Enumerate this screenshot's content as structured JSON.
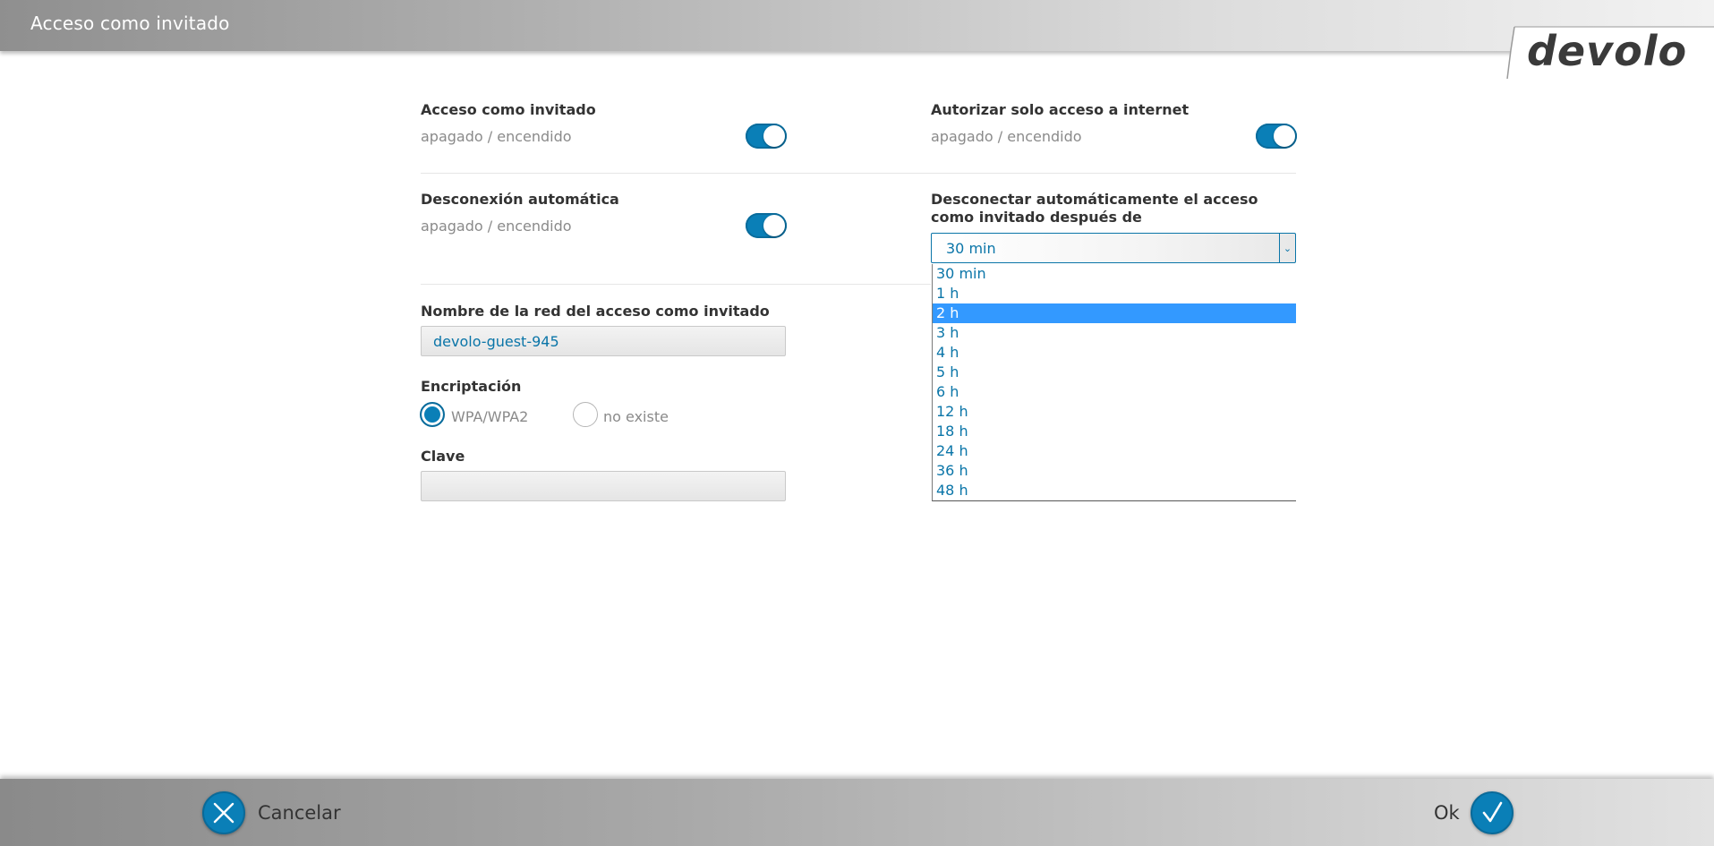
{
  "header": {
    "title": "Acceso como invitado",
    "logo_text": "devolo"
  },
  "guest_access": {
    "title": "Acceso como invitado",
    "sub": "apagado / encendido",
    "enabled": true
  },
  "internet_only": {
    "title": "Autorizar solo acceso a internet",
    "sub": "apagado / encendido",
    "enabled": true
  },
  "auto_disconnect": {
    "title": "Desconexión automática",
    "sub": "apagado / encendido",
    "enabled": true
  },
  "disconnect_after": {
    "title": "Desconectar automáticamente el acceso como invitado después de",
    "value": "30 min",
    "options": [
      "30 min",
      "1 h",
      "2 h",
      "3 h",
      "4 h",
      "5 h",
      "6 h",
      "12 h",
      "18 h",
      "24 h",
      "36 h",
      "48 h"
    ],
    "highlighted": "2 h"
  },
  "network_name": {
    "title": "Nombre de la red del acceso como invitado",
    "value": "devolo-guest-945"
  },
  "encryption": {
    "title": "Encriptación",
    "options": [
      {
        "label": "WPA/WPA2",
        "checked": true
      },
      {
        "label": "no existe",
        "checked": false
      }
    ]
  },
  "key": {
    "title": "Clave",
    "value": ""
  },
  "footer": {
    "cancel_label": "Cancelar",
    "ok_label": "Ok"
  },
  "colors": {
    "accent": "#0a7fb7",
    "highlight": "#3399ff"
  }
}
